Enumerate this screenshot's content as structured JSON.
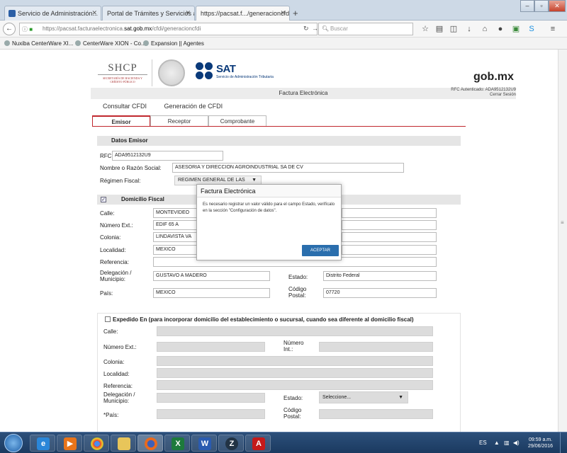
{
  "browser": {
    "tabs": [
      {
        "label": "Servicio de Administración..."
      },
      {
        "label": "Portal de Trámites y Servicios a..."
      },
      {
        "label": "https://pacsat.f.../generacioncfdi"
      }
    ],
    "url_prefix": "https://pacsat.facturaelectronica.",
    "url_domain": "sat.gob.mx",
    "url_path": "/cfdi/generacioncfdi",
    "search_placeholder": "Buscar",
    "bookmarks": [
      "Nuxiba CenterWare XI...",
      "CenterWare XION - Co...",
      "Expansion || Agentes"
    ]
  },
  "header": {
    "shcp": "SHCP",
    "shcp_sub": "SECRETARÍA DE HACIENDA Y CRÉDITO PÚBLICO",
    "sat": "SAT",
    "sat_sub": "Servicio de Administración Tributaria",
    "gob": "gob.mx",
    "bar_title": "Factura Electrónica",
    "rfc_auth": "RFC Autenticado: ADA9512132U9",
    "logout": "Cerrar Sesión"
  },
  "menu": {
    "consultar": "Consultar CFDI",
    "generacion": "Generación de CFDI"
  },
  "subtabs": {
    "emisor": "Emisor",
    "receptor": "Receptor",
    "comprobante": "Comprobante"
  },
  "datos_emisor": {
    "title": "Datos Emisor",
    "rfc_label": "RFC:",
    "rfc": "ADA9512132U9",
    "nombre_label": "Nombre o Razón Social:",
    "nombre": "ASESORIA Y DIRECCION AGROINDUSTRIAL SA DE CV",
    "regimen_label": "Régimen Fiscal:",
    "regimen": "REGIMEN GENERAL DE LAS"
  },
  "domicilio": {
    "title": "Domicilio Fiscal",
    "checked": "✓",
    "calle_label": "Calle:",
    "calle": "MONTEVIDEO",
    "numext_label": "Número Ext.:",
    "numext": "EDIF 65 A",
    "colonia_label": "Colonia:",
    "colonia": "LINDAVISTA VA",
    "localidad_label": "Localidad:",
    "localidad": "MEXICO",
    "referencia_label": "Referencia:",
    "delegacion_label": "Delegación / Municipio:",
    "delegacion": "GUSTAVO A MADERO",
    "estado_label": "Estado:",
    "estado": "Distrito Federal",
    "pais_label": "País:",
    "pais": "MEXICO",
    "cp_label": "Código Postal:",
    "cp": "07720"
  },
  "expedido": {
    "title": "Expedido En (para incorporar domicilio del establecimiento o sucursal, cuando sea diferente al domicilio fiscal)",
    "calle_label": "Calle:",
    "numext_label": "Número Ext.:",
    "numint_label": "Número Int.:",
    "colonia_label": "Colonia:",
    "localidad_label": "Localidad:",
    "referencia_label": "Referencia:",
    "delegacion_label": "Delegación / Municipio:",
    "estado_label": "Estado:",
    "estado_select": "Seleccione...",
    "pais_label": "*País:",
    "cp_label": "Código Postal:"
  },
  "modal": {
    "title": "Factura Electrónica",
    "body": "Es necesario registrar un valor válido para el campo Estado, verifícalo en la sección \"Configuración de datos\".",
    "button": "ACEPTAR"
  },
  "taskbar": {
    "lang": "ES",
    "time": "09:59 a.m.",
    "date": "29/06/2016"
  }
}
